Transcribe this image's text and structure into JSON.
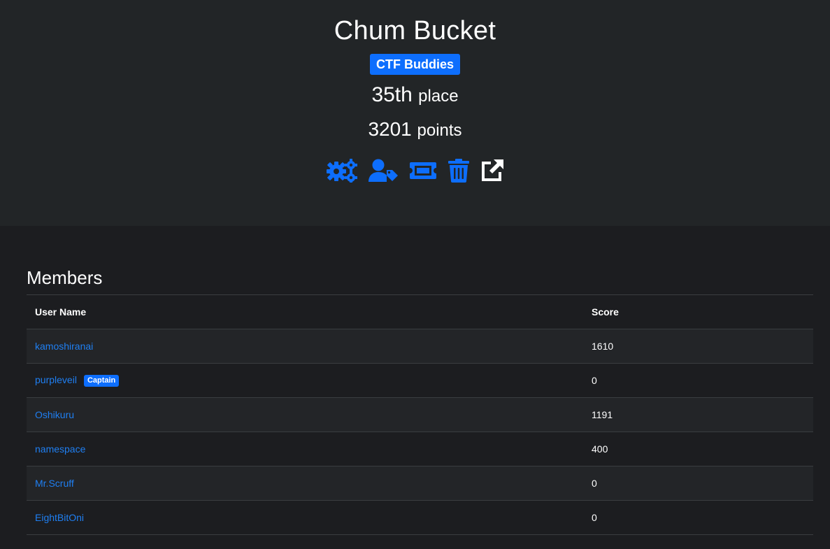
{
  "team": {
    "name": "Chum Bucket",
    "affiliation": "CTF Buddies",
    "place_value": "35th",
    "place_unit": "place",
    "points_value": "3201",
    "points_unit": "points"
  },
  "actions": [
    {
      "icon": "gears-icon",
      "color": "#0d6efd"
    },
    {
      "icon": "user-tag-icon",
      "color": "#0d6efd"
    },
    {
      "icon": "ticket-icon",
      "color": "#0d6efd"
    },
    {
      "icon": "trash-icon",
      "color": "#0d6efd"
    },
    {
      "icon": "external-link-icon",
      "color": "#ffffff"
    }
  ],
  "members": {
    "title": "Members",
    "columns": [
      "User Name",
      "Score"
    ],
    "rows": [
      {
        "name": "kamoshiranai",
        "score": "1610",
        "badge": ""
      },
      {
        "name": "purpleveil",
        "score": "0",
        "badge": "Captain"
      },
      {
        "name": "Oshikuru",
        "score": "1191",
        "badge": ""
      },
      {
        "name": "namespace",
        "score": "400",
        "badge": ""
      },
      {
        "name": "Mr.Scruff",
        "score": "0",
        "badge": ""
      },
      {
        "name": "EightBitOni",
        "score": "0",
        "badge": ""
      }
    ]
  },
  "colors": {
    "accent": "#0d6efd",
    "link": "#1f7ff2",
    "header_bg": "#222527",
    "page_bg": "#1c1d20"
  }
}
